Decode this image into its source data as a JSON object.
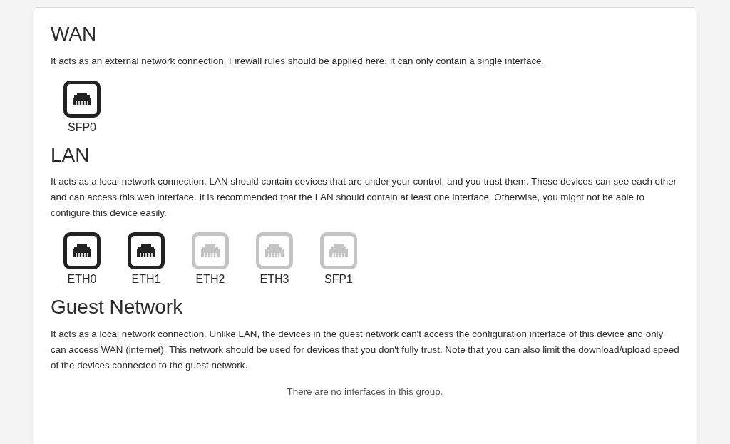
{
  "groups": [
    {
      "title": "WAN",
      "description": "It acts as an external network connection. Firewall rules should be applied here. It can only contain a single interface.",
      "ports": [
        {
          "label": "SFP0",
          "connected": true
        }
      ]
    },
    {
      "title": "LAN",
      "description": "It acts as a local network connection. LAN should contain devices that are under your control, and you trust them. These devices can see each other and can access this web interface. It is recommended that the LAN should contain at least one interface. Otherwise, you might not be able to configure this device easily.",
      "ports": [
        {
          "label": "ETH0",
          "connected": true
        },
        {
          "label": "ETH1",
          "connected": true
        },
        {
          "label": "ETH2",
          "connected": false
        },
        {
          "label": "ETH3",
          "connected": false
        },
        {
          "label": "SFP1",
          "connected": false
        }
      ]
    },
    {
      "title": "Guest Network",
      "description": "It acts as a local network connection. Unlike LAN, the devices in the guest network can't access the configuration interface of this device and only can access WAN (internet). This network should be used for devices that you don't fully trust. Note that you can also limit the download/upload speed of the devices connected to the guest network.",
      "empty_message": "There are no interfaces in this group."
    }
  ]
}
